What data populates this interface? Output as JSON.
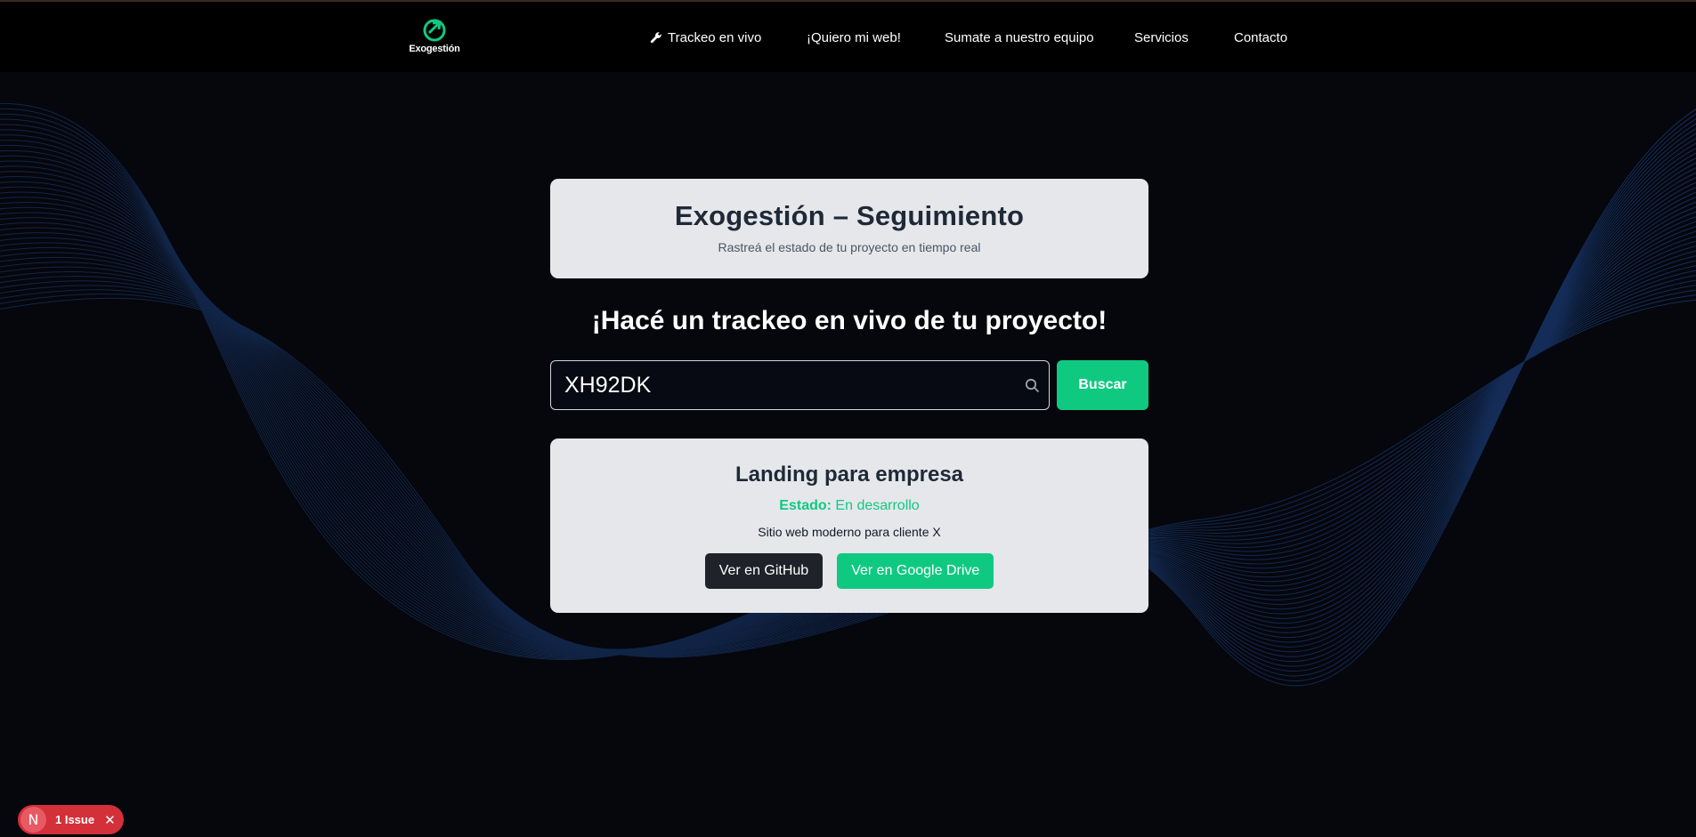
{
  "brand": {
    "logo_text": "Exogestión",
    "accent": "#10c981"
  },
  "nav": {
    "items": [
      {
        "label": "Trackeo en vivo",
        "icon": "wrench-icon"
      },
      {
        "label": "¡Quiero mi web!"
      },
      {
        "label": "Sumate a nuestro equipo"
      },
      {
        "label": "Servicios"
      },
      {
        "label": "Contacto"
      }
    ]
  },
  "header_card": {
    "title": "Exogestión – Seguimiento",
    "subtitle": "Rastreá el estado de tu proyecto en tiempo real"
  },
  "headline": "¡Hacé un trackeo en vivo de tu proyecto!",
  "search": {
    "value": "XH92DK",
    "button_label": "Buscar",
    "icon": "search-icon"
  },
  "result": {
    "title": "Landing para empresa",
    "status_label": "Estado:",
    "status_value": "En desarrollo",
    "description": "Sitio web moderno para cliente X",
    "github_button": "Ver en GitHub",
    "drive_button": "Ver en Google Drive"
  },
  "issue_badge": {
    "logo_letter": "N",
    "label": "1 Issue",
    "close_symbol": "✕",
    "color": "#d4303a"
  }
}
